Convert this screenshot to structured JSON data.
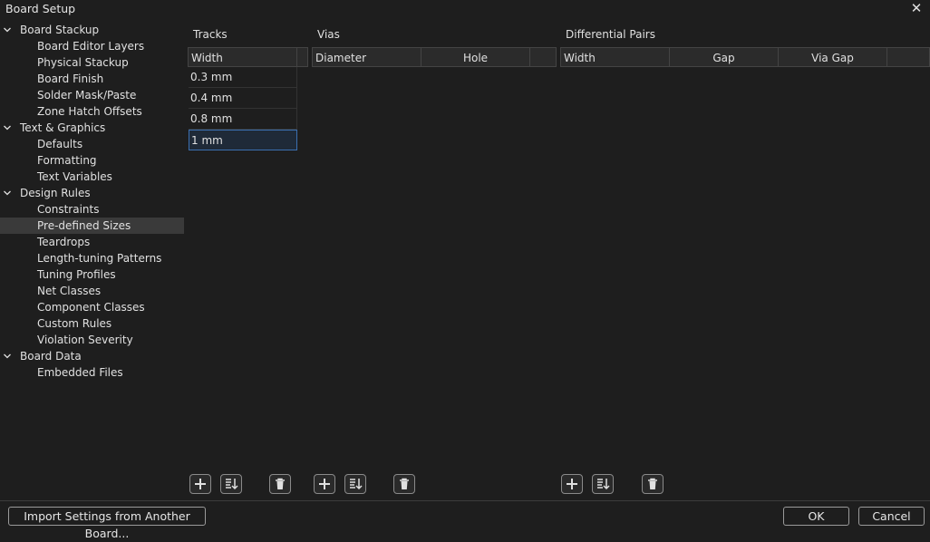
{
  "window": {
    "title": "Board Setup",
    "close_glyph": "✕"
  },
  "tree": {
    "groups": [
      {
        "label": "Board Stackup",
        "children": [
          "Board Editor Layers",
          "Physical Stackup",
          "Board Finish",
          "Solder Mask/Paste",
          "Zone Hatch Offsets"
        ]
      },
      {
        "label": "Text & Graphics",
        "children": [
          "Defaults",
          "Formatting",
          "Text Variables"
        ]
      },
      {
        "label": "Design Rules",
        "children": [
          "Constraints",
          "Pre-defined Sizes",
          "Teardrops",
          "Length-tuning Patterns",
          "Tuning Profiles",
          "Net Classes",
          "Component Classes",
          "Custom Rules",
          "Violation Severity"
        ]
      },
      {
        "label": "Board Data",
        "children": [
          "Embedded Files"
        ]
      }
    ],
    "selected": "Pre-defined Sizes"
  },
  "tracks": {
    "title": "Tracks",
    "columns": [
      "Width"
    ],
    "rows": [
      "0.3 mm",
      "0.4 mm",
      "0.8 mm",
      "1 mm"
    ]
  },
  "vias": {
    "title": "Vias",
    "columns": [
      "Diameter",
      "Hole"
    ]
  },
  "diff_pairs": {
    "title": "Differential Pairs",
    "columns": [
      "Width",
      "Gap",
      "Via Gap"
    ]
  },
  "icons": {
    "add": "plus-icon",
    "sort": "sort-icon",
    "delete": "trash-icon"
  },
  "footer": {
    "import_label": "Import Settings from Another Board...",
    "ok_label": "OK",
    "cancel_label": "Cancel"
  },
  "colors": {
    "background": "#1e1e1e",
    "selection_border": "#3b6fb0",
    "tree_selected": "#3a3a3a"
  }
}
